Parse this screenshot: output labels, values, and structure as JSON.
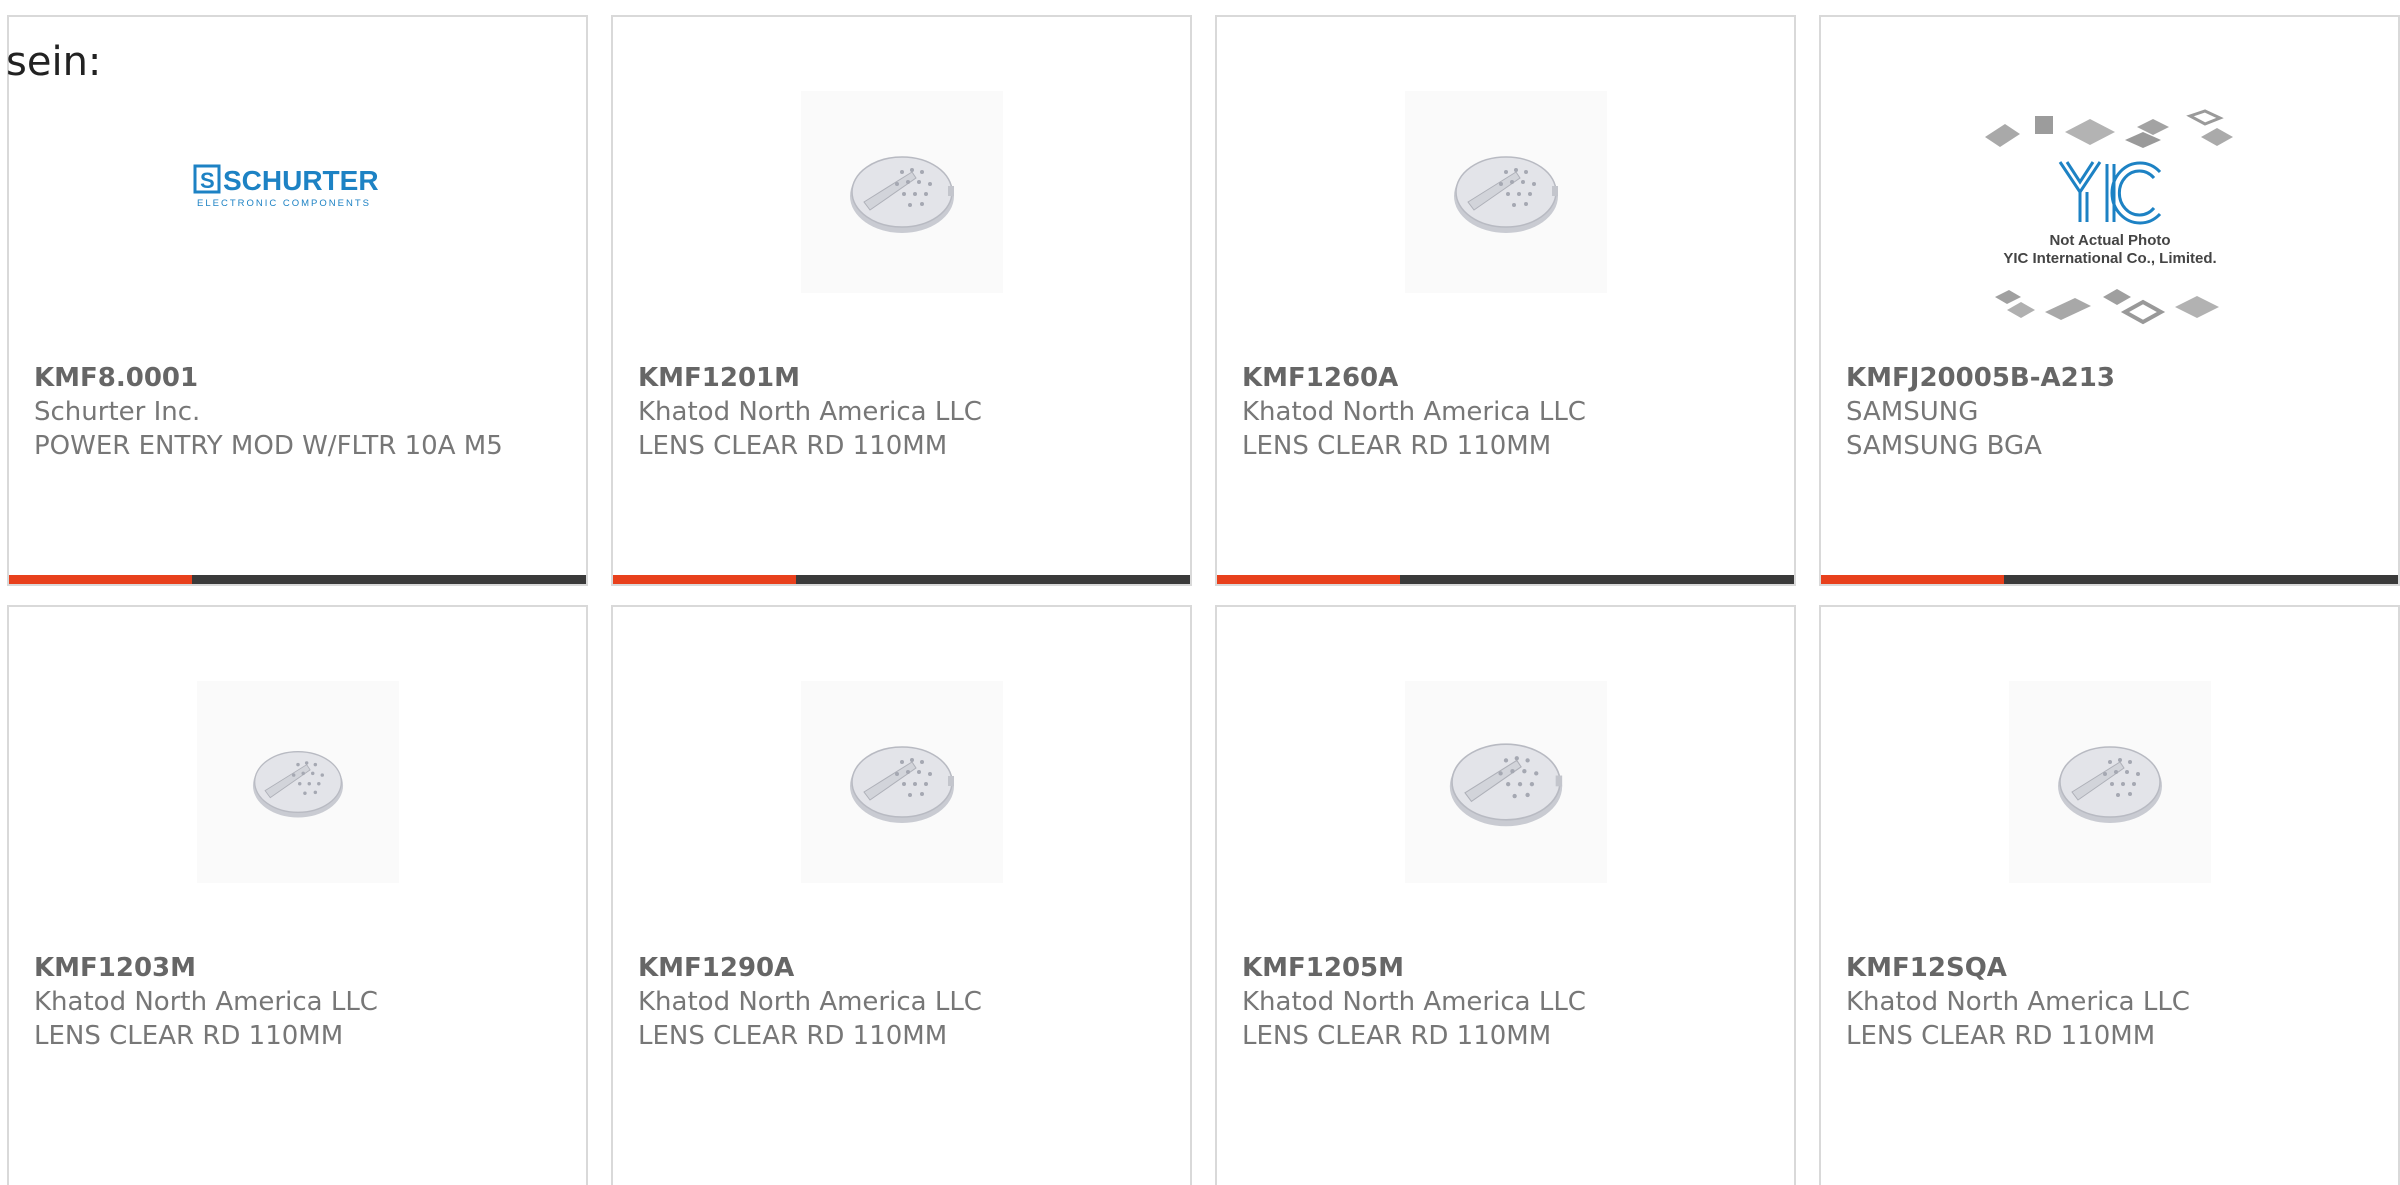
{
  "page": {
    "heading": "sein:"
  },
  "colors": {
    "accent": "#e8401c",
    "bar": "#3a3a3a",
    "card_border": "#d9d9d9",
    "part_text": "#666666",
    "meta_text": "#777777",
    "schurter_blue": "#1d82c4"
  },
  "products": [
    {
      "part": "KMF8.0001",
      "manufacturer": "Schurter Inc.",
      "description": "POWER ENTRY MOD W/FLTR 10A M5",
      "image": "schurter-logo",
      "logo": {
        "name": "SCHURTER",
        "sub": "ELECTRONIC COMPONENTS"
      }
    },
    {
      "part": "KMF1201M",
      "manufacturer": "Khatod North America LLC",
      "description": "LENS CLEAR RD 110MM",
      "image": "lens-photo"
    },
    {
      "part": "KMF1260A",
      "manufacturer": "Khatod North America LLC",
      "description": "LENS CLEAR RD 110MM",
      "image": "lens-photo"
    },
    {
      "part": "KMFJ20005B-A213",
      "manufacturer": "SAMSUNG",
      "description": "SAMSUNG BGA",
      "image": "yic-placeholder",
      "logo": {
        "name": "YIC",
        "line1": "Not Actual Photo",
        "line2": "YIC International Co., Limited."
      }
    },
    {
      "part": "KMF1203M",
      "manufacturer": "Khatod North America LLC",
      "description": "LENS CLEAR RD 110MM",
      "image": "lens-photo"
    },
    {
      "part": "KMF1290A",
      "manufacturer": "Khatod North America LLC",
      "description": "LENS CLEAR RD 110MM",
      "image": "lens-photo"
    },
    {
      "part": "KMF1205M",
      "manufacturer": "Khatod North America LLC",
      "description": "LENS CLEAR RD 110MM",
      "image": "lens-photo"
    },
    {
      "part": "KMF12SQA",
      "manufacturer": "Khatod North America LLC",
      "description": "LENS CLEAR RD 110MM",
      "image": "lens-photo"
    }
  ]
}
